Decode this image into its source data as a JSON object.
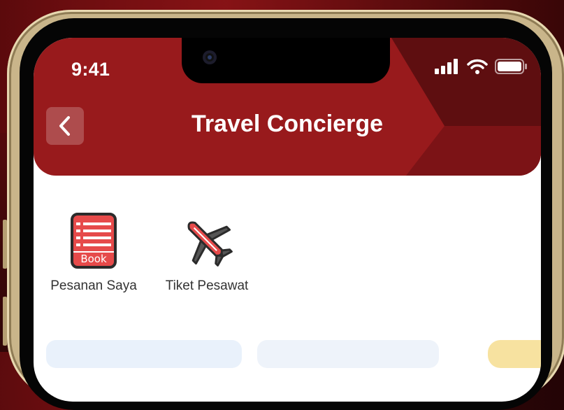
{
  "status_bar": {
    "time": "9:41",
    "icons": [
      "signal-icon",
      "wifi-icon",
      "battery-icon"
    ]
  },
  "header": {
    "title": "Travel Concierge",
    "back_icon": "chevron-left-icon",
    "color": "#981a1c"
  },
  "menu": {
    "items": [
      {
        "label": "Pesanan Saya",
        "icon": "book-icon"
      },
      {
        "label": "Tiket Pesawat",
        "icon": "airplane-icon"
      }
    ]
  }
}
